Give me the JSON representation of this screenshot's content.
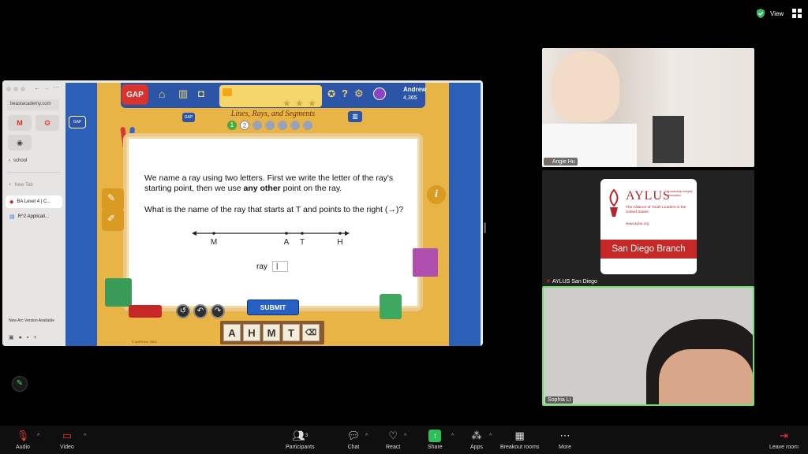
{
  "view": {
    "label": "View"
  },
  "browser": {
    "url": "beastacademy.com",
    "folder": "school",
    "new_tab": "New Tab",
    "tabs": [
      "BA Level 4 | C...",
      "R^2 Applicati..."
    ],
    "update_notice": "New Arc Version Available"
  },
  "game": {
    "logo": "GAP",
    "user_name": "Andrew",
    "user_coins": "4,365",
    "progress": 0.1,
    "stars_total": 3,
    "lesson_title": "Lines, Rays, and Segments",
    "steps": [
      "1",
      "2",
      "",
      "",
      "",
      "",
      ""
    ],
    "question_p1_before": "We name a ray using two letters. First we write the letter of the ray's starting point, then we use ",
    "question_p1_bold": "any other",
    "question_p1_after": " point on the ray.",
    "question_p2": "What is the name of the ray that starts at T and points to the right (→)?",
    "line_points": [
      "M",
      "A",
      "T",
      "H"
    ],
    "answer_label": "ray",
    "answer_value": "|",
    "submit_label": "SUBMIT",
    "keys": [
      "A",
      "H",
      "M",
      "T"
    ],
    "info": "i",
    "copyright": "© AoPS Inc. 2023"
  },
  "participants": [
    {
      "name": "Angie Hu"
    },
    {
      "name": "AYLUS San Diego"
    },
    {
      "name": "Sophia Li"
    }
  ],
  "aylus": {
    "title": "AYLUS",
    "motto": "Leadership Integrity Innovation",
    "subtitle": "The Alliance of Youth Leaders in the United States",
    "url": "www.aylus.org",
    "branch": "San Diego Branch"
  },
  "toolbar": {
    "audio": "Audio",
    "video": "Video",
    "participants": "Participants",
    "participant_count": "3",
    "chat": "Chat",
    "react": "React",
    "share": "Share",
    "apps": "Apps",
    "breakout": "Breakout rooms",
    "more": "More",
    "leave": "Leave room"
  }
}
